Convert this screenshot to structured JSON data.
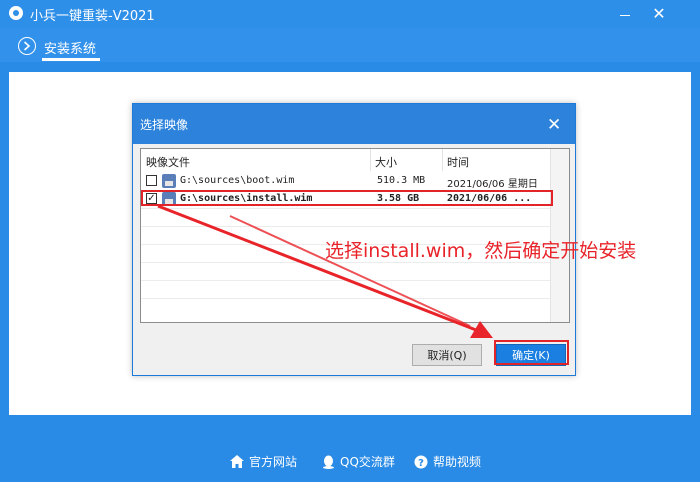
{
  "window": {
    "title": "小兵一键重装-V2021",
    "minimize_glyph": "—",
    "close_glyph": "✕"
  },
  "tab": {
    "label": "安装系统"
  },
  "dialog": {
    "title": "选择映像",
    "close_glyph": "✕",
    "columns": [
      "映像文件",
      "大小",
      "时间"
    ],
    "rows": [
      {
        "checked": "",
        "file": "G:\\sources\\boot.wim",
        "size": "510.3 MB",
        "time": "2021/06/06  星期日"
      },
      {
        "checked": "✓",
        "file": "G:\\sources\\install.wim",
        "size": "3.58 GB",
        "time": "2021/06/06  ..."
      }
    ],
    "cancel_label": "取消(Q)",
    "ok_label": "确定(K)"
  },
  "annotation": {
    "text": "选择install.wim，然后确定开始安装",
    "color": "#e8242a"
  },
  "footer": {
    "items": [
      {
        "label": "官方网站",
        "icon": "home-icon"
      },
      {
        "label": "QQ交流群",
        "icon": "qq-icon"
      },
      {
        "label": "帮助视频",
        "icon": "help-icon"
      }
    ]
  },
  "colors": {
    "primary": "#2a8be6",
    "dialog_title": "#2d83dc",
    "ok_button": "#1a7fe0",
    "highlight": "#e0242a"
  }
}
